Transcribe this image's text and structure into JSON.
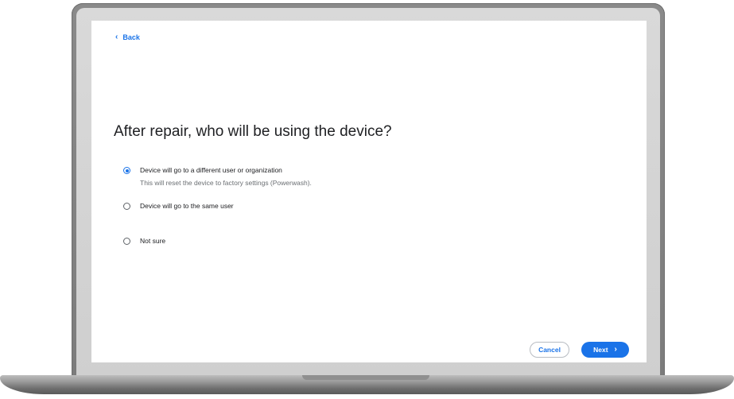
{
  "nav": {
    "back_label": "Back",
    "back_icon": "chevron-left-icon"
  },
  "page": {
    "title": "After repair, who will be using the device?"
  },
  "options": [
    {
      "label": "Device will go to a different user or organization",
      "sublabel": "This will reset the device to factory settings (Powerwash).",
      "selected": true
    },
    {
      "label": "Device will go to the same user",
      "selected": false
    },
    {
      "label": "Not sure",
      "selected": false
    }
  ],
  "footer": {
    "cancel_label": "Cancel",
    "next_label": "Next",
    "next_icon": "chevron-right-icon"
  },
  "colors": {
    "accent": "#1a73e8",
    "text": "#202124",
    "subtext": "#6b6f73"
  }
}
